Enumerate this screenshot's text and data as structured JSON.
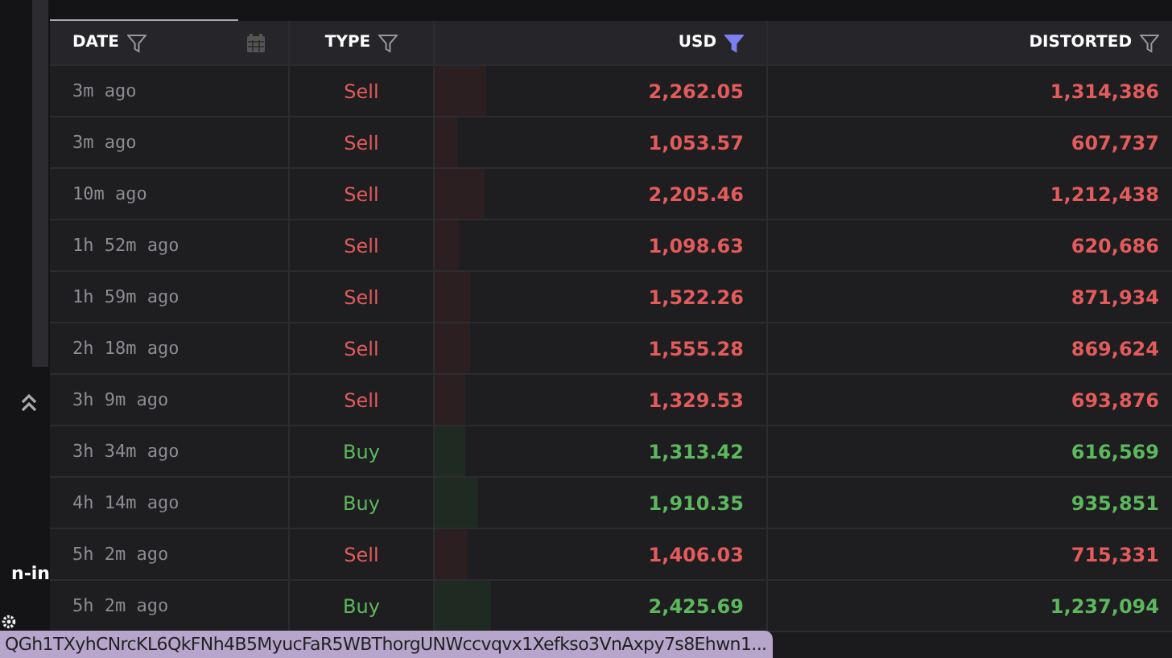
{
  "sidebar": {
    "label": "n-in"
  },
  "table": {
    "columns": [
      {
        "label": "DATE",
        "filter_active": false
      },
      {
        "label": "TYPE",
        "filter_active": false
      },
      {
        "label": "USD",
        "filter_active": true
      },
      {
        "label": "DISTORTED",
        "filter_active": false
      }
    ],
    "rows": [
      {
        "time": "3m ago",
        "type": "Sell",
        "kind": "sell",
        "usd": "2,262.05",
        "level": 0.155,
        "distorted": "1,314,386"
      },
      {
        "time": "3m ago",
        "type": "Sell",
        "kind": "sell",
        "usd": "1,053.57",
        "level": 0.07,
        "distorted": "607,737"
      },
      {
        "time": "10m ago",
        "type": "Sell",
        "kind": "sell",
        "usd": "2,205.46",
        "level": 0.15,
        "distorted": "1,212,438"
      },
      {
        "time": "1h 52m ago",
        "type": "Sell",
        "kind": "sell",
        "usd": "1,098.63",
        "level": 0.075,
        "distorted": "620,686"
      },
      {
        "time": "1h 59m ago",
        "type": "Sell",
        "kind": "sell",
        "usd": "1,522.26",
        "level": 0.105,
        "distorted": "871,934"
      },
      {
        "time": "2h 18m ago",
        "type": "Sell",
        "kind": "sell",
        "usd": "1,555.28",
        "level": 0.105,
        "distorted": "869,624"
      },
      {
        "time": "3h 9m ago",
        "type": "Sell",
        "kind": "sell",
        "usd": "1,329.53",
        "level": 0.09,
        "distorted": "693,876"
      },
      {
        "time": "3h 34m ago",
        "type": "Buy",
        "kind": "buy",
        "usd": "1,313.42",
        "level": 0.09,
        "distorted": "616,569"
      },
      {
        "time": "4h 14m ago",
        "type": "Buy",
        "kind": "buy",
        "usd": "1,910.35",
        "level": 0.13,
        "distorted": "935,851"
      },
      {
        "time": "5h 2m ago",
        "type": "Sell",
        "kind": "sell",
        "usd": "1,406.03",
        "level": 0.095,
        "distorted": "715,331"
      },
      {
        "time": "5h 2m ago",
        "type": "Buy",
        "kind": "buy",
        "usd": "2,425.69",
        "level": 0.17,
        "distorted": "1,237,094"
      }
    ]
  },
  "tooltip": {
    "text": "QGh1TXyhCNrcKL6QkFNh4B5MyucFaR5WBThorgUNWccvqvx1Xefkso3VnAxpy7s8Ehwn1..."
  }
}
